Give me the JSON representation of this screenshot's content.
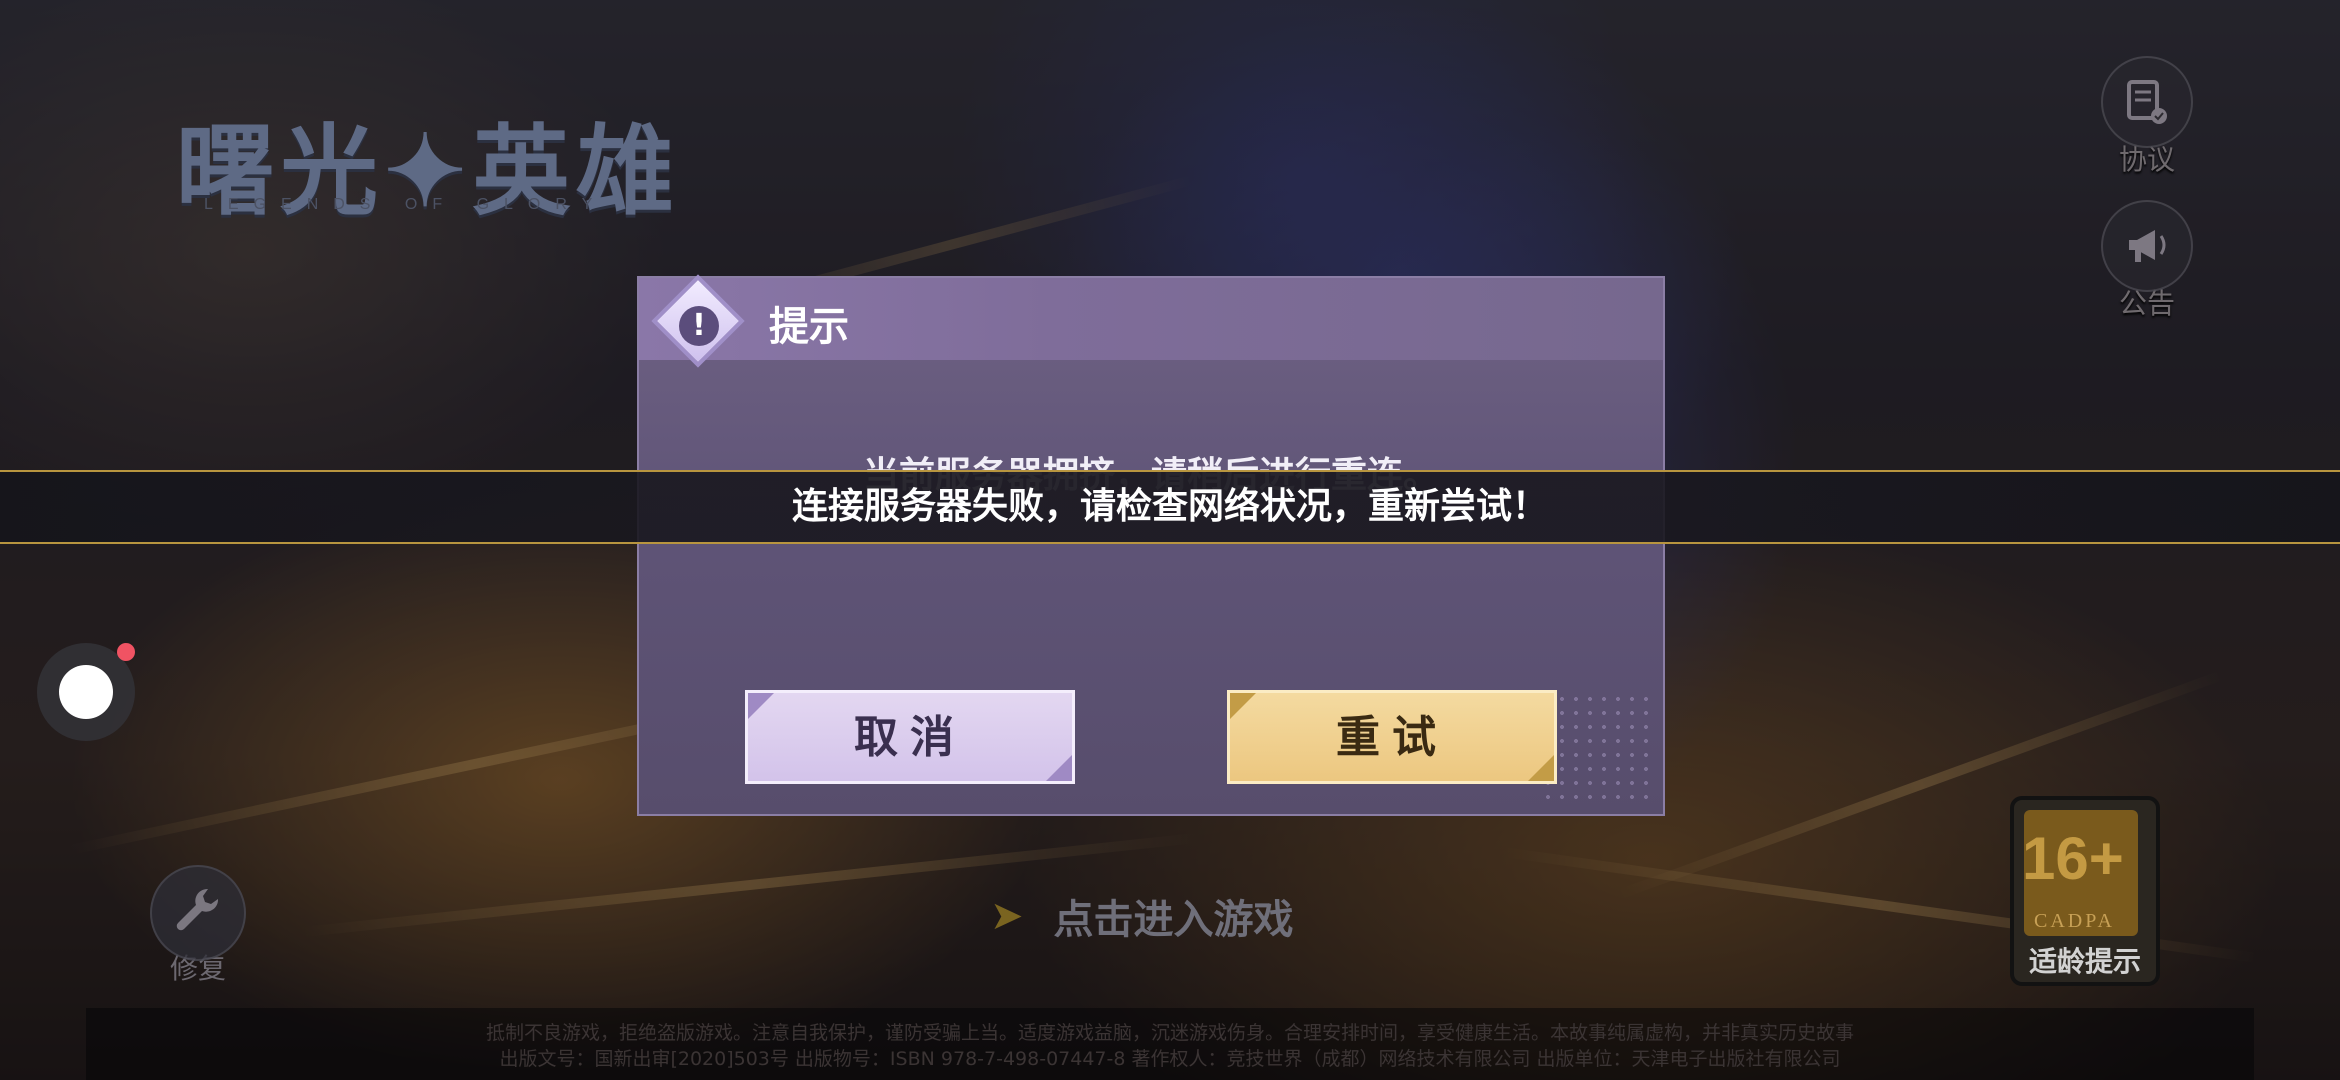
{
  "logo": {
    "title": "曙光✦英雄",
    "subtitle": "LEGENDS OF GLORY"
  },
  "side_buttons": {
    "agreement_label": "协议",
    "notice_label": "公告"
  },
  "enter_game": {
    "label": "点击进入游戏",
    "arrow": "➤"
  },
  "repair": {
    "label": "修复"
  },
  "age_rating": {
    "number": "16+",
    "org": "CADPA",
    "tip": "适龄提示"
  },
  "footer": {
    "line1": "抵制不良游戏，拒绝盗版游戏。注意自我保护，谨防受骗上当。适度游戏益脑，沉迷游戏伤身。合理安排时间，享受健康生活。本故事纯属虚构，并非真实历史故事",
    "line2": "出版文号：国新出审[2020]503号  出版物号：ISBN 978-7-498-07447-8  著作权人：竞技世界（成都）网络技术有限公司  出版单位：天津电子出版社有限公司"
  },
  "dialog": {
    "title": "提示",
    "badge_symbol": "!",
    "message": "当前服务器拥挤，请稍后进行重连。",
    "cancel_label": "取消",
    "retry_label": "重试"
  },
  "toast": {
    "message": "连接服务器失败，请检查网络状况，重新尝试！"
  },
  "colors": {
    "dialog_bg": "#5f5477",
    "cancel_bg": "#dccff0",
    "retry_bg": "#f0d08e",
    "toast_border": "#b8953f",
    "badge_dot": "#f05363"
  }
}
